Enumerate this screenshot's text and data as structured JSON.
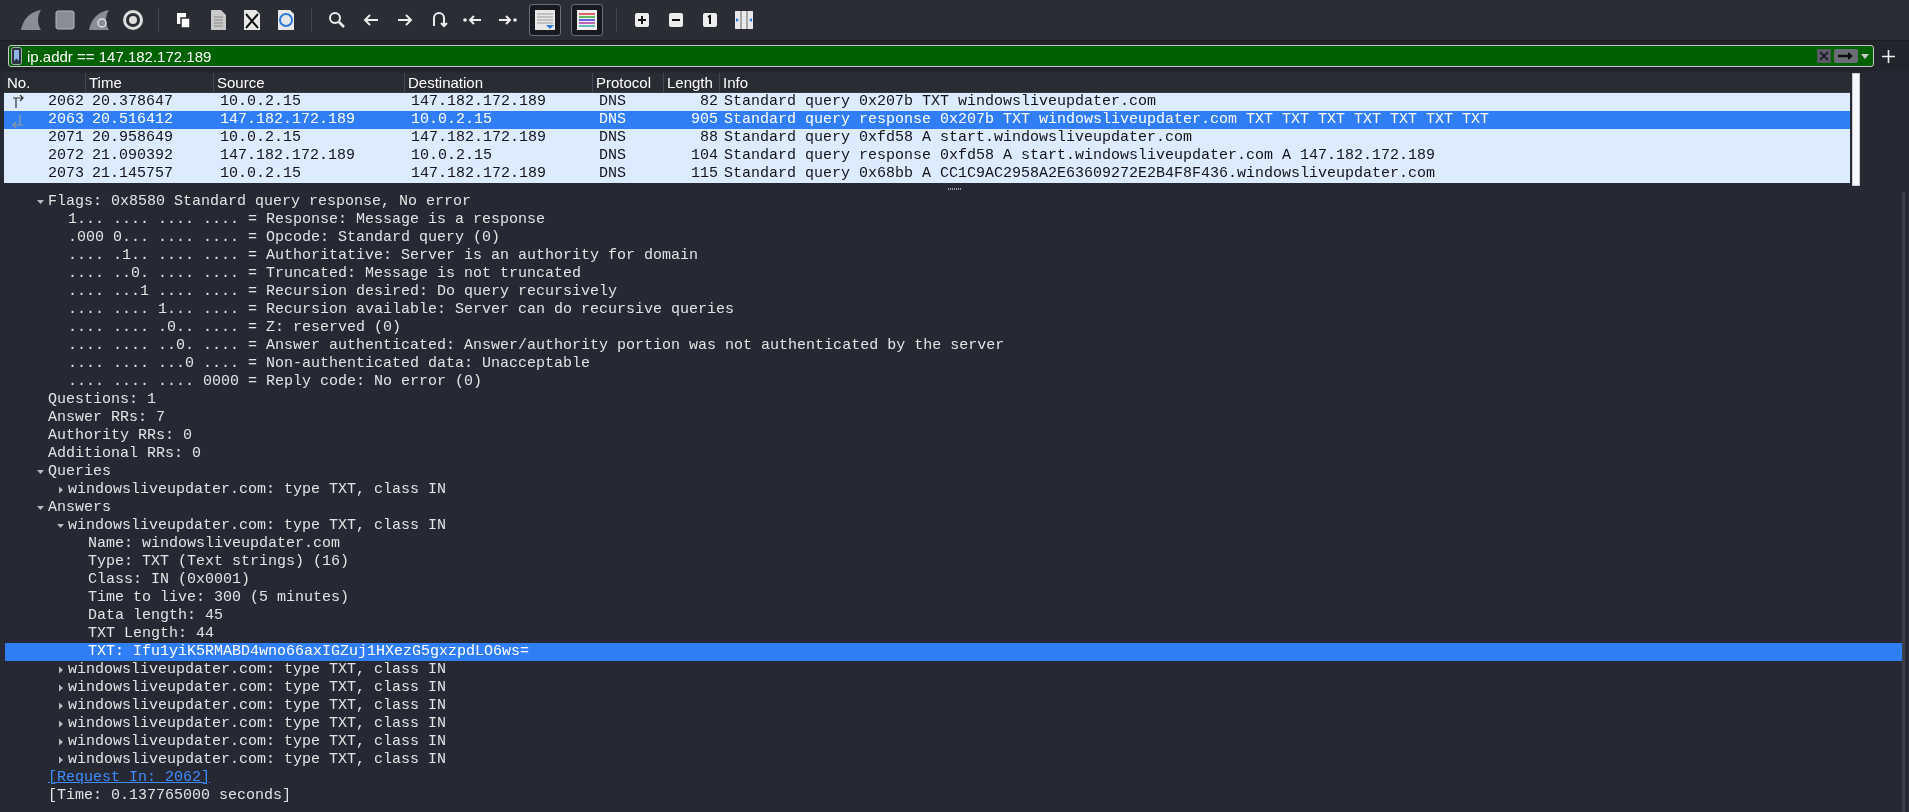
{
  "toolbar": {
    "auto_scroll": {
      "on": true
    },
    "colorize": {
      "on": true
    }
  },
  "display_filter": {
    "value": "ip.addr == 147.182.172.189"
  },
  "packet_list": {
    "columns": [
      "No.",
      "Time",
      "Source",
      "Destination",
      "Protocol",
      "Length",
      "Info"
    ],
    "rows": [
      {
        "cells": [
          "2062",
          "20.378647",
          "10.0.2.15",
          "147.182.172.189",
          "DNS",
          "82",
          "Standard query 0x207b TXT windowsliveupdater.com"
        ],
        "selected": false,
        "kind": "request"
      },
      {
        "cells": [
          "2063",
          "20.516412",
          "147.182.172.189",
          "10.0.2.15",
          "DNS",
          "905",
          "Standard query response 0x207b TXT windowsliveupdater.com TXT TXT TXT TXT TXT TXT TXT"
        ],
        "selected": true,
        "kind": "response"
      },
      {
        "cells": [
          "2071",
          "20.958649",
          "10.0.2.15",
          "147.182.172.189",
          "DNS",
          "88",
          "Standard query 0xfd58 A start.windowsliveupdater.com"
        ],
        "selected": false,
        "kind": "plain"
      },
      {
        "cells": [
          "2072",
          "21.090392",
          "147.182.172.189",
          "10.0.2.15",
          "DNS",
          "104",
          "Standard query response 0xfd58 A start.windowsliveupdater.com A 147.182.172.189"
        ],
        "selected": false,
        "kind": "plain"
      },
      {
        "cells": [
          "2073",
          "21.145757",
          "10.0.2.15",
          "147.182.172.189",
          "DNS",
          "115",
          "Standard query 0x68bb A CC1C9AC2958A2E63609272E2B4F8F436.windowsliveupdater.com"
        ],
        "selected": false,
        "kind": "plain"
      }
    ]
  },
  "packet_details": [
    {
      "text": "Flags: 0x8580 Standard query response, No error",
      "expanded": true,
      "selected": false,
      "children": [
        {
          "text": "1... .... .... .... = Response: Message is a response",
          "selected": false
        },
        {
          "text": ".000 0... .... .... = Opcode: Standard query (0)",
          "selected": false
        },
        {
          "text": ".... .1.. .... .... = Authoritative: Server is an authority for domain",
          "selected": false
        },
        {
          "text": ".... ..0. .... .... = Truncated: Message is not truncated",
          "selected": false
        },
        {
          "text": ".... ...1 .... .... = Recursion desired: Do query recursively",
          "selected": false
        },
        {
          "text": ".... .... 1... .... = Recursion available: Server can do recursive queries",
          "selected": false
        },
        {
          "text": ".... .... .0.. .... = Z: reserved (0)",
          "selected": false
        },
        {
          "text": ".... .... ..0. .... = Answer authenticated: Answer/authority portion was not authenticated by the server",
          "selected": false
        },
        {
          "text": ".... .... ...0 .... = Non-authenticated data: Unacceptable",
          "selected": false
        },
        {
          "text": ".... .... .... 0000 = Reply code: No error (0)",
          "selected": false
        }
      ]
    },
    {
      "text": "Questions: 1",
      "selected": false
    },
    {
      "text": "Answer RRs: 7",
      "selected": false
    },
    {
      "text": "Authority RRs: 0",
      "selected": false
    },
    {
      "text": "Additional RRs: 0",
      "selected": false
    },
    {
      "text": "Queries",
      "expanded": true,
      "selected": false,
      "children": [
        {
          "text": "windowsliveupdater.com: type TXT, class IN",
          "expanded": false,
          "selected": false
        }
      ]
    },
    {
      "text": "Answers",
      "expanded": true,
      "selected": false,
      "children": [
        {
          "text": "windowsliveupdater.com: type TXT, class IN",
          "expanded": true,
          "selected": false,
          "children": [
            {
              "text": "Name: windowsliveupdater.com",
              "selected": false
            },
            {
              "text": "Type: TXT (Text strings) (16)",
              "selected": false
            },
            {
              "text": "Class: IN (0x0001)",
              "selected": false
            },
            {
              "text": "Time to live: 300 (5 minutes)",
              "selected": false
            },
            {
              "text": "Data length: 45",
              "selected": false
            },
            {
              "text": "TXT Length: 44",
              "selected": false
            },
            {
              "text": "TXT: Ifu1yiK5RMABD4wno66axIGZuj1HXezG5gxzpdLO6ws=",
              "selected": true
            }
          ]
        },
        {
          "text": "windowsliveupdater.com: type TXT, class IN",
          "expanded": false,
          "selected": false
        },
        {
          "text": "windowsliveupdater.com: type TXT, class IN",
          "expanded": false,
          "selected": false
        },
        {
          "text": "windowsliveupdater.com: type TXT, class IN",
          "expanded": false,
          "selected": false
        },
        {
          "text": "windowsliveupdater.com: type TXT, class IN",
          "expanded": false,
          "selected": false
        },
        {
          "text": "windowsliveupdater.com: type TXT, class IN",
          "expanded": false,
          "selected": false
        },
        {
          "text": "windowsliveupdater.com: type TXT, class IN",
          "expanded": false,
          "selected": false
        }
      ]
    },
    {
      "text": "[Request In: 2062]",
      "kind": "link",
      "selected": false
    },
    {
      "text": "[Time: 0.137765000 seconds]",
      "selected": false
    }
  ]
}
